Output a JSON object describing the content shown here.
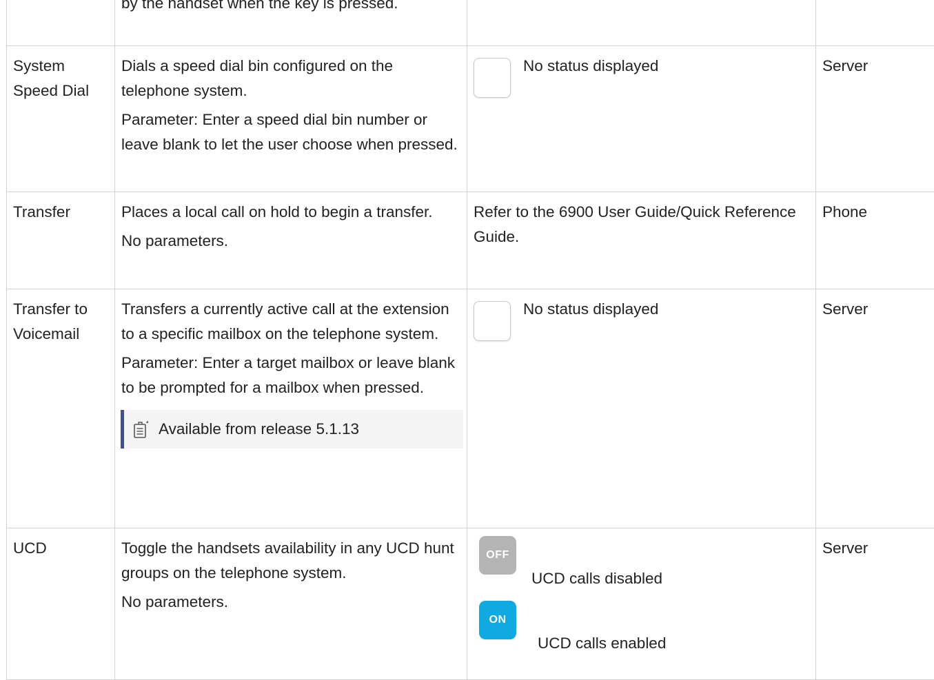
{
  "rows": [
    {
      "name": "",
      "description": [
        "by the handset when the key is pressed."
      ],
      "status": "",
      "location": ""
    },
    {
      "name": "System Speed Dial",
      "description": [
        "Dials a speed dial bin configured on the telephone system.",
        "Parameter: Enter a speed dial bin number or leave blank to let the user choose when pressed."
      ],
      "status": "No status displayed",
      "location": "Server"
    },
    {
      "name": "Transfer",
      "description": [
        "Places a local call on hold to begin a transfer.",
        "No parameters."
      ],
      "status": "Refer to the 6900 User Guide/Quick Reference Guide.",
      "location": "Phone"
    },
    {
      "name": "Transfer to Voicemail",
      "description": [
        "Transfers a currently active call at the extension to a specific mailbox on the telephone system.",
        "Parameter: Enter a target mailbox or leave blank to be prompted for a mailbox when pressed."
      ],
      "note": "Available from release 5.1.13",
      "status": "No status displayed",
      "location": "Server"
    },
    {
      "name": "UCD",
      "description": [
        "Toggle the handsets availability in any UCD hunt groups on the telephone system.",
        "No parameters."
      ],
      "ucd_states": [
        {
          "badge": "OFF",
          "label": "UCD calls disabled",
          "color": "#b4b4b4"
        },
        {
          "badge": "ON",
          "label": "UCD calls enabled",
          "color": "#11a9e2"
        }
      ],
      "location": "Server"
    }
  ],
  "icons": {
    "status_placeholder": "status-placeholder-icon",
    "note": "note-icon"
  },
  "colors": {
    "border": "#d3d3d3",
    "note_bar": "#3d4e93",
    "note_bg": "#f4f4f4"
  }
}
